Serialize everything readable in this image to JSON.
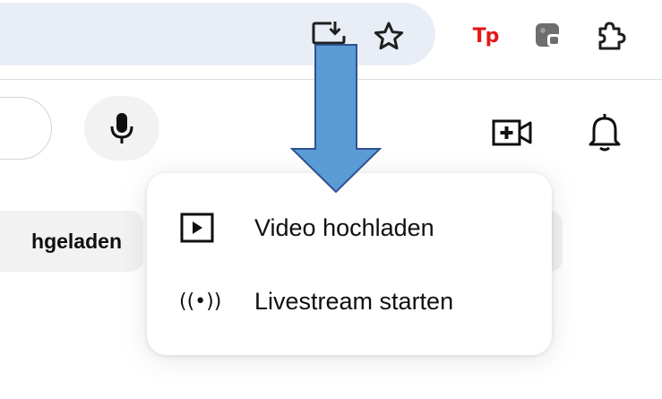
{
  "browser": {
    "extension_tp_label": "Tp"
  },
  "icons": {
    "install": "install-app-icon",
    "star": "bookmark-star-icon",
    "tp": "tp-extension-icon",
    "gray_extension": "gray-extension-icon",
    "puzzle": "extensions-puzzle-icon",
    "mic": "microphone-icon",
    "create": "create-video-icon",
    "bell": "notifications-bell-icon",
    "play": "play-icon",
    "live": "livestream-icon",
    "arrow": "annotation-arrow"
  },
  "chips": {
    "partial_label": "hgeladen"
  },
  "menu": {
    "items": [
      {
        "label": "Video hochladen"
      },
      {
        "label": "Livestream starten"
      }
    ],
    "live_glyph": "((•))"
  },
  "colors": {
    "omnibox_bg": "#e9eef6",
    "chip_bg": "#f2f2f2",
    "tp_red": "#e31919",
    "arrow_fill": "#5b9bd5",
    "arrow_stroke": "#2f528f"
  }
}
